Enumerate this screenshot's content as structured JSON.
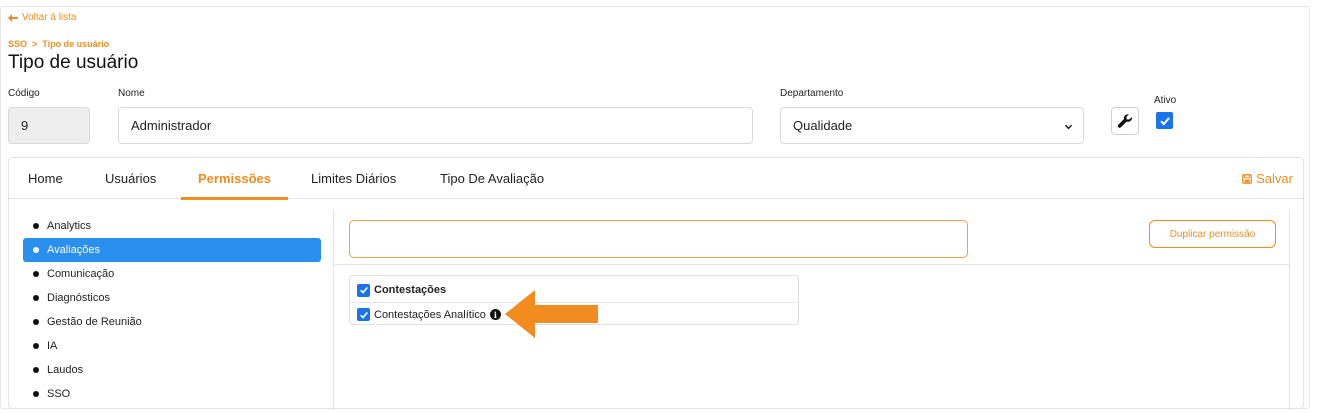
{
  "back_link": "Voltar à lista",
  "breadcrumb": {
    "root": "SSO",
    "separator": ">",
    "current": "Tipo de usuário"
  },
  "page_title": "Tipo de usuário",
  "form": {
    "codigo_label": "Código",
    "codigo_value": "9",
    "nome_label": "Nome",
    "nome_value": "Administrador",
    "departamento_label": "Departamento",
    "departamento_value": "Qualidade",
    "ativo_label": "Ativo",
    "ativo_checked": true
  },
  "tabs": [
    {
      "label": "Home"
    },
    {
      "label": "Usuários"
    },
    {
      "label": "Permissões",
      "active": true
    },
    {
      "label": "Limites Diários"
    },
    {
      "label": "Tipo De Avaliação"
    }
  ],
  "save_label": "Salvar",
  "sidebar": {
    "items": [
      {
        "label": "Analytics"
      },
      {
        "label": "Avaliações",
        "active": true
      },
      {
        "label": "Comunicação"
      },
      {
        "label": "Diagnósticos"
      },
      {
        "label": "Gestão de Reunião"
      },
      {
        "label": "IA"
      },
      {
        "label": "Laudos"
      },
      {
        "label": "SSO"
      }
    ]
  },
  "filter": {
    "value": "",
    "placeholder": ""
  },
  "duplicate_button": "Duplicar permissão",
  "permissions": {
    "group_label": "Contestações",
    "group_checked": true,
    "items": [
      {
        "label": "Contestações Analítico",
        "checked": true,
        "info_icon": "i"
      }
    ]
  },
  "colors": {
    "accent": "#f28c1e",
    "active_item": "#2b8ff0",
    "checkbox": "#1a73e8",
    "annotation_arrow": "#f28c1e"
  }
}
